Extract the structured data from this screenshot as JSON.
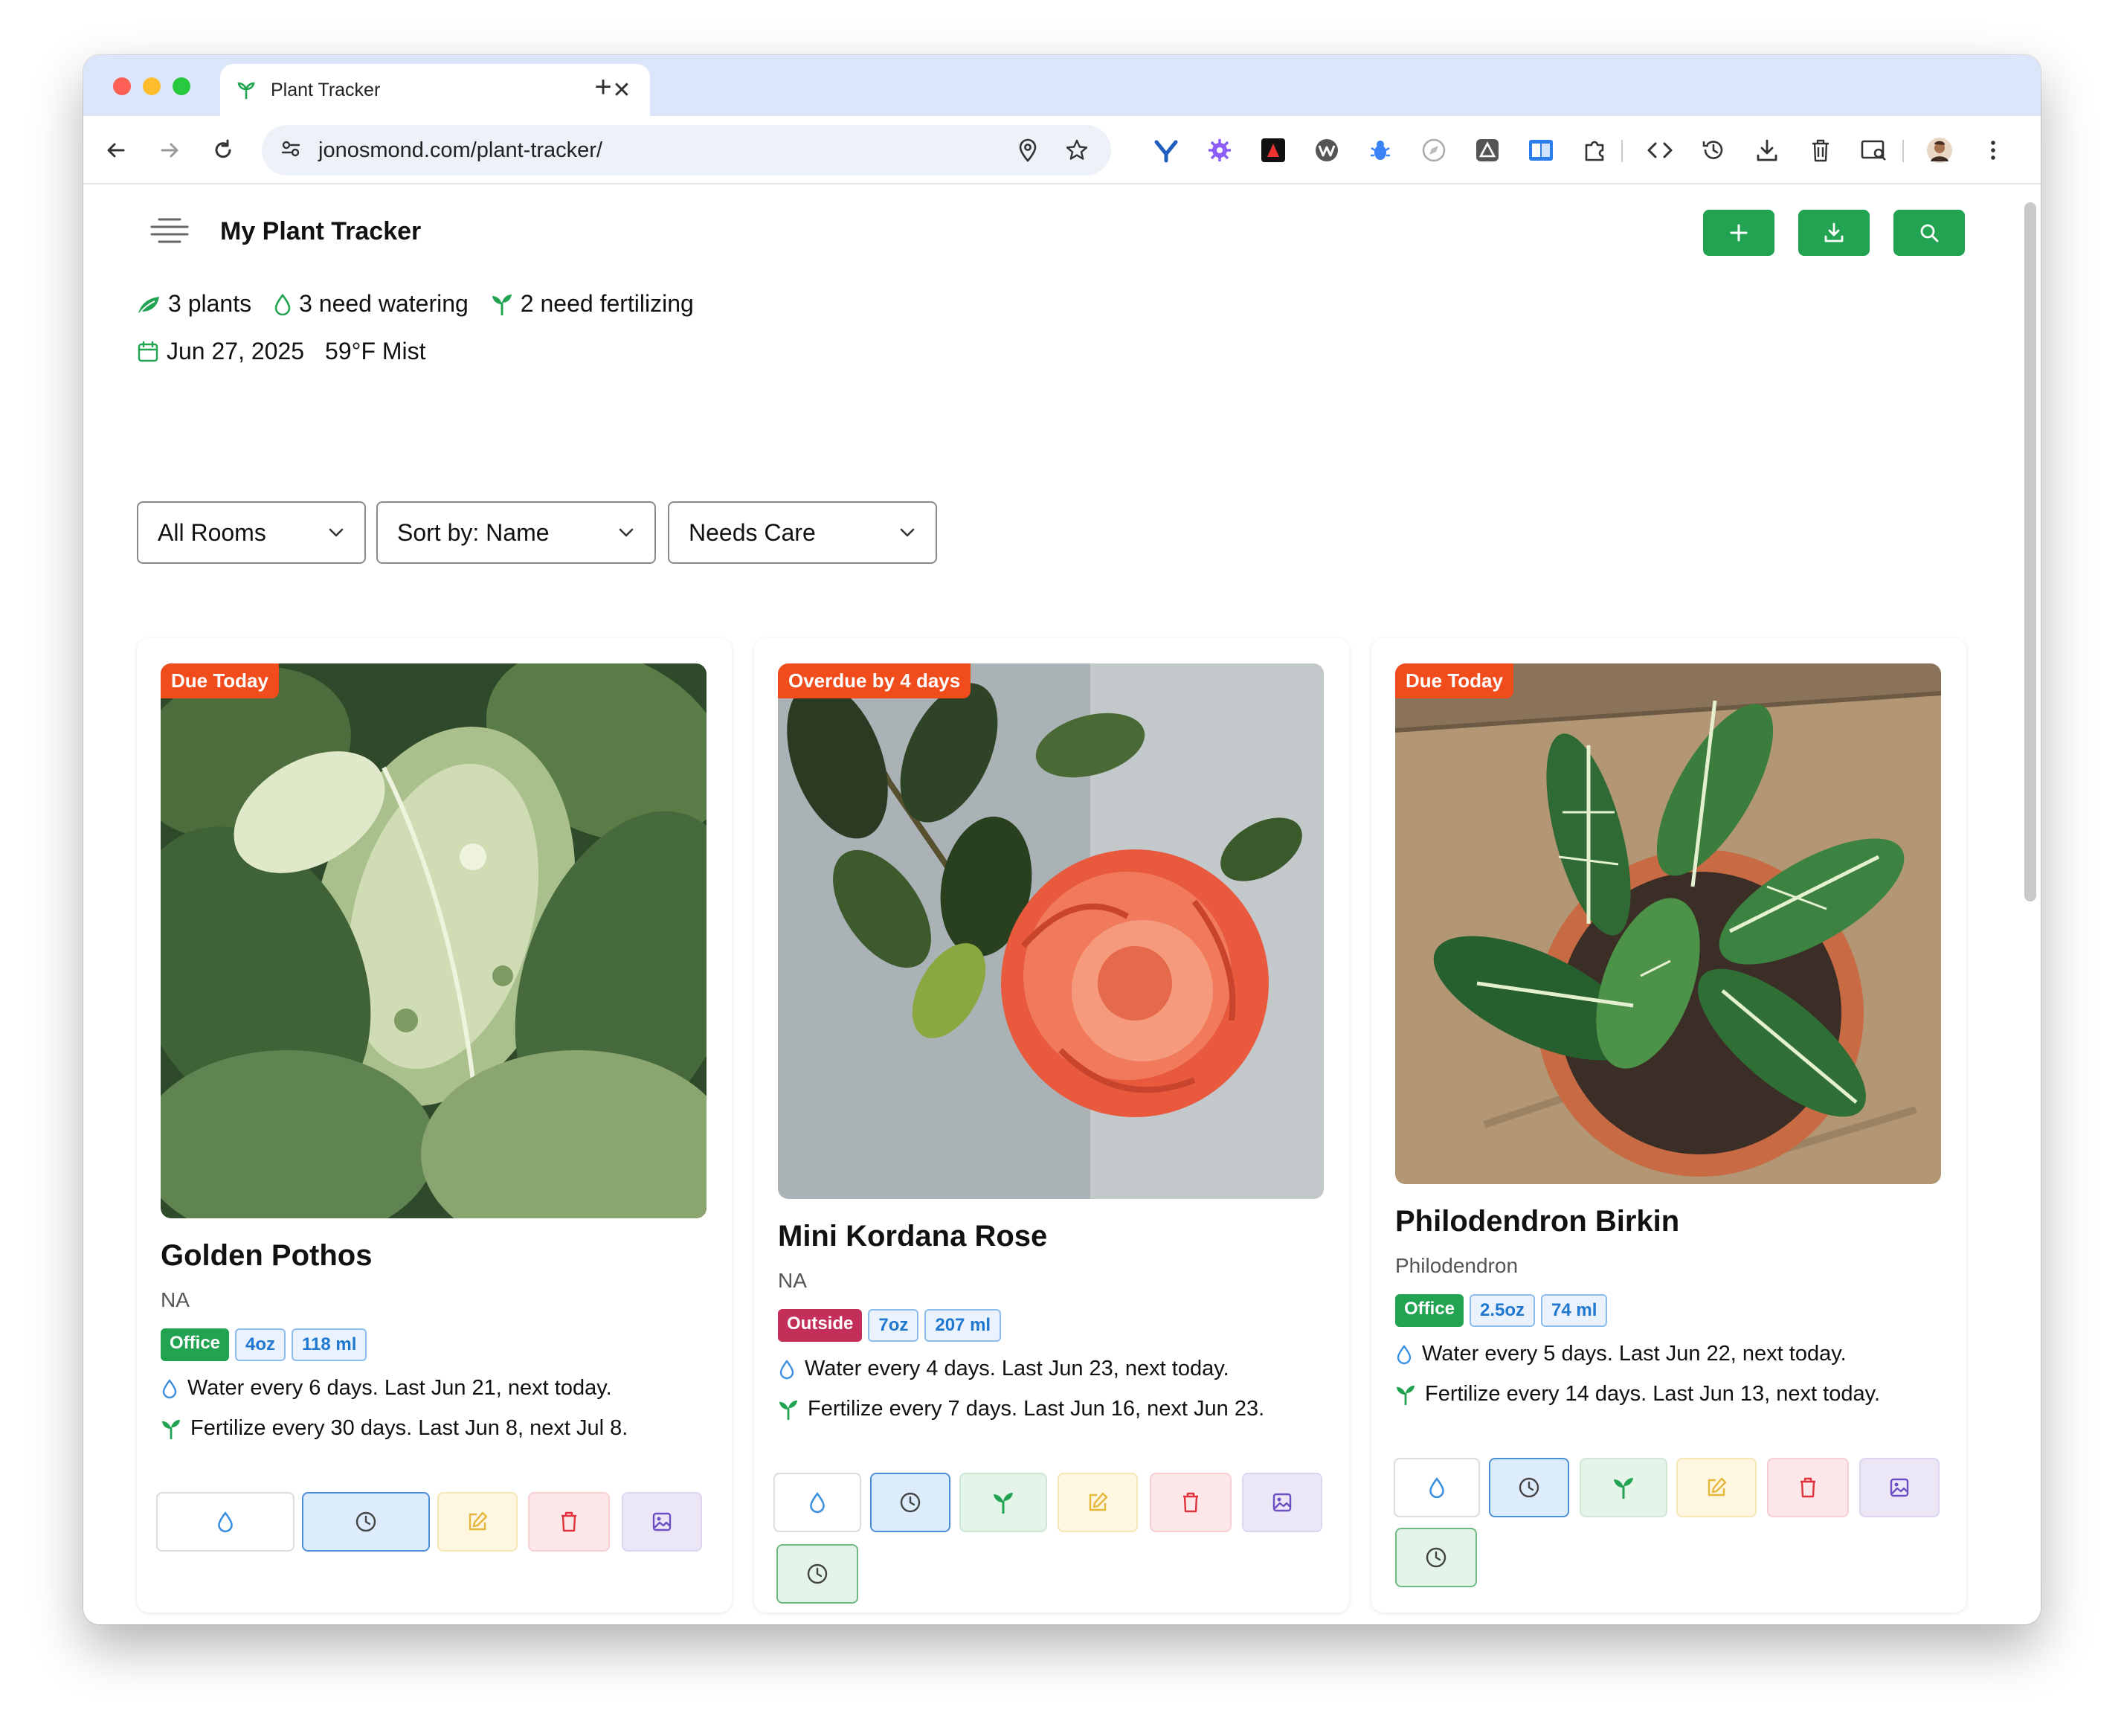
{
  "browser": {
    "tab_title": "Plant Tracker",
    "url": "jonosmond.com/plant-tracker/"
  },
  "app": {
    "title": "My Plant Tracker"
  },
  "stats": {
    "plants": "3 plants",
    "watering": "3 need watering",
    "fertilizing": "2 need fertilizing"
  },
  "conditions": {
    "date": "Jun 27, 2025",
    "weather": "59°F Mist"
  },
  "filters": {
    "room": "All Rooms",
    "sort": "Sort by: Name",
    "status": "Needs Care"
  },
  "plants": [
    {
      "status": "Due Today",
      "name": "Golden Pothos",
      "scientific": "NA",
      "room": "Office",
      "amount_oz": "4oz",
      "amount_ml": "118 ml",
      "water": "Water every 6 days. Last Jun 21, next today.",
      "fertilize": "Fertilize every 30 days. Last Jun 8, next Jul 8."
    },
    {
      "status": "Overdue by 4 days",
      "name": "Mini Kordana Rose",
      "scientific": "NA",
      "room": "Outside",
      "amount_oz": "7oz",
      "amount_ml": "207 ml",
      "water": "Water every 4 days. Last Jun 23, next today.",
      "fertilize": "Fertilize every 7 days. Last Jun 16, next Jun 23."
    },
    {
      "status": "Due Today",
      "name": "Philodendron Birkin",
      "scientific": "Philodendron",
      "room": "Office",
      "amount_oz": "2.5oz",
      "amount_ml": "74 ml",
      "water": "Water every 5 days. Last Jun 22, next today.",
      "fertilize": "Fertilize every 14 days. Last Jun 13, next today."
    }
  ],
  "colors": {
    "brand_green": "#22a352",
    "badge_orange": "#f04c1c",
    "water_blue": "#1f77d0",
    "outside_tag": "#c42f59"
  },
  "icons": {
    "header_buttons": [
      "plus-icon",
      "download-icon",
      "search-icon"
    ],
    "card_actions": [
      "water-drop-icon",
      "clock-icon",
      "sprout-icon",
      "edit-icon",
      "trash-icon",
      "image-icon"
    ]
  }
}
